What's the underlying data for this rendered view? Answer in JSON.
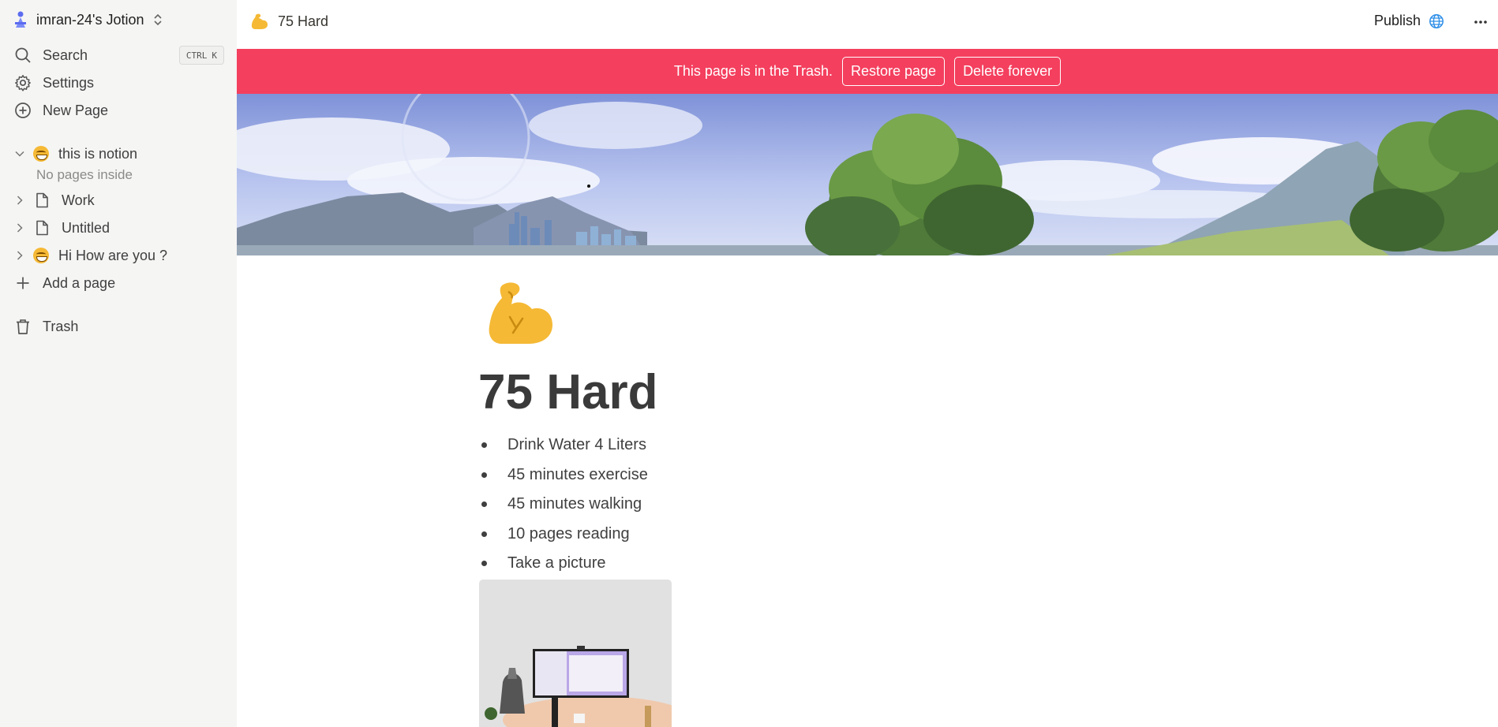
{
  "sidebar": {
    "workspace_name": "imran-24's Jotion",
    "search_label": "Search",
    "search_shortcut_mod": "CTRL",
    "search_shortcut_key": "K",
    "settings_label": "Settings",
    "new_page_label": "New Page",
    "pages": [
      {
        "label": "this is notion",
        "icon": "grinning-face-icon",
        "expanded": true
      },
      {
        "label": "Work",
        "icon": "document-icon",
        "expanded": false
      },
      {
        "label": "Untitled",
        "icon": "document-icon",
        "expanded": false
      },
      {
        "label": "Hi How are you ?",
        "icon": "grinning-face-icon",
        "expanded": false
      }
    ],
    "empty_children_text": "No pages inside",
    "add_page_label": "Add a page",
    "trash_label": "Trash"
  },
  "topbar": {
    "page_title": "75 Hard",
    "page_icon": "flexed-biceps-icon",
    "publish_label": "Publish"
  },
  "banner": {
    "message": "This page is in the Trash.",
    "restore_label": "Restore page",
    "delete_label": "Delete forever",
    "color": "#f43f5e"
  },
  "page": {
    "title": "75 Hard",
    "icon": "flexed-biceps-icon",
    "bullets": [
      "Drink Water 4 Liters",
      "45 minutes exercise",
      "45 minutes walking",
      "10 pages reading",
      "Take a picture"
    ]
  }
}
